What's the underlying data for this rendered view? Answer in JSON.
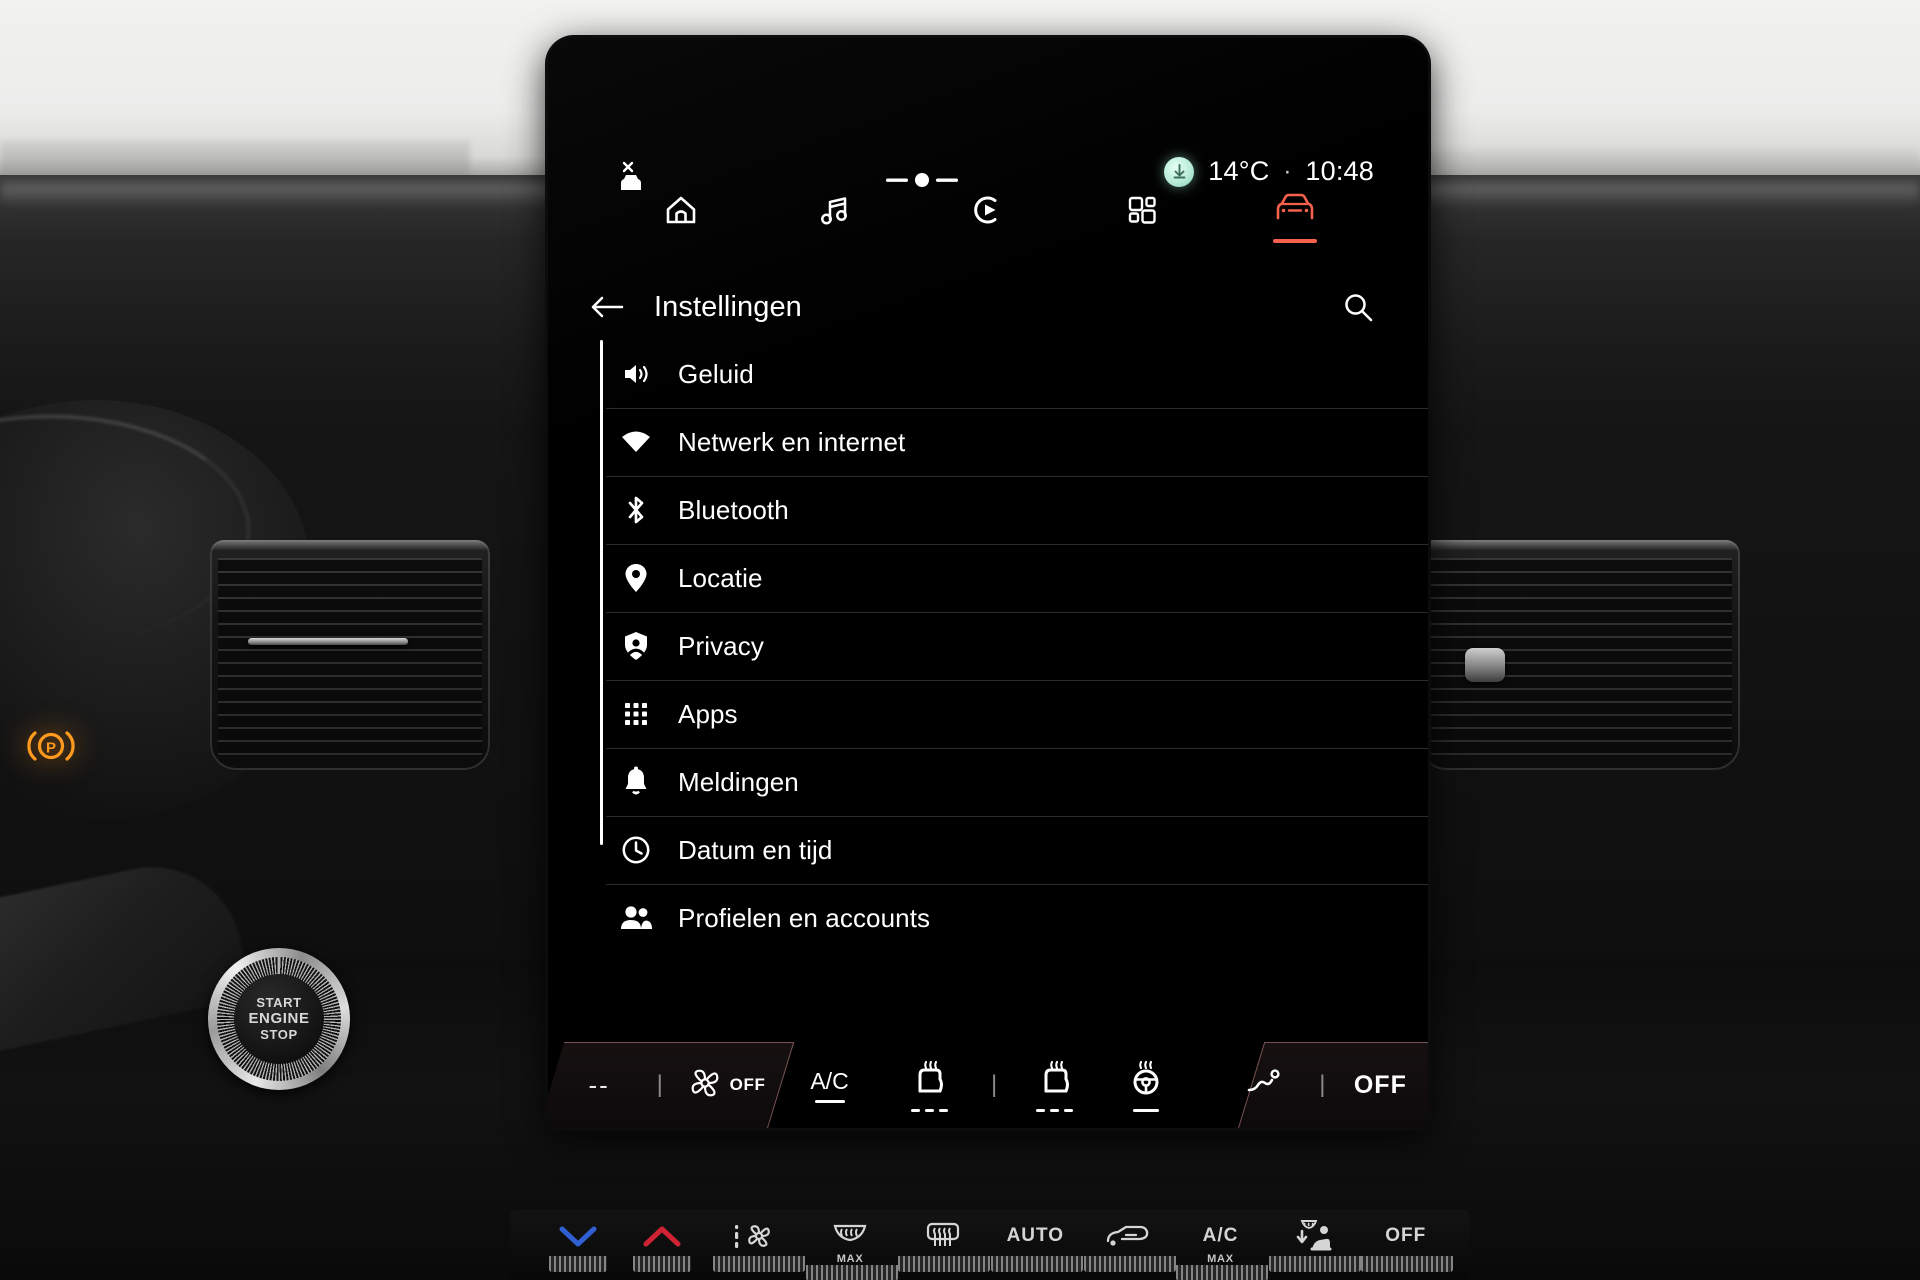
{
  "status": {
    "vehicle_icon": "car-disconnected-icon",
    "volume_icon": "volume-slider-icon",
    "badge_icon": "download-circle-icon",
    "temperature": "14°C",
    "separator": "·",
    "time": "10:48"
  },
  "nav": {
    "items": [
      {
        "name": "home",
        "icon": "home-icon",
        "label": "Home",
        "active": false
      },
      {
        "name": "media",
        "icon": "music-note-icon",
        "label": "Media",
        "active": false
      },
      {
        "name": "radio",
        "icon": "play-circle-icon",
        "label": "Radio",
        "active": false
      },
      {
        "name": "apps",
        "icon": "apps-grid-icon",
        "label": "Apps",
        "active": false
      },
      {
        "name": "vehicle",
        "icon": "car-icon",
        "label": "Voertuig",
        "active": true
      }
    ],
    "active_color": "#f4614d"
  },
  "header": {
    "back_icon": "back-arrow-icon",
    "title": "Instellingen",
    "search_icon": "search-icon"
  },
  "settings": {
    "items": [
      {
        "icon": "speaker-icon",
        "label": "Geluid"
      },
      {
        "icon": "wifi-icon",
        "label": "Netwerk en internet"
      },
      {
        "icon": "bluetooth-icon",
        "label": "Bluetooth"
      },
      {
        "icon": "location-pin-icon",
        "label": "Locatie"
      },
      {
        "icon": "shield-person-icon",
        "label": "Privacy"
      },
      {
        "icon": "apps-dots-icon",
        "label": "Apps"
      },
      {
        "icon": "bell-icon",
        "label": "Meldingen"
      },
      {
        "icon": "clock-icon",
        "label": "Datum en tijd"
      },
      {
        "icon": "people-icon",
        "label": "Profielen en accounts"
      }
    ],
    "scrollbar": {
      "visible": true
    }
  },
  "climate": {
    "left_temp": "--",
    "fan_icon": "fan-icon",
    "fan_state": "OFF",
    "ac_label": "A/C",
    "seat_heat_driver_icon": "heated-seat-icon",
    "seat_heat_passenger_icon": "heated-seat-icon",
    "steering_heat_icon": "heated-steering-wheel-icon",
    "airflow_icon": "airflow-icon",
    "right_state": "OFF"
  },
  "hvac_panel": {
    "buttons": [
      {
        "name": "temp-down",
        "icon": "chevron-down-icon",
        "label": "",
        "sub": "",
        "color": "#2f5fd0"
      },
      {
        "name": "temp-up",
        "icon": "chevron-up-icon",
        "label": "",
        "sub": "",
        "color": "#cf2233"
      },
      {
        "name": "fan-speed",
        "icon": "fan-bars-icon",
        "label": "",
        "sub": ""
      },
      {
        "name": "front-defrost",
        "icon": "front-defrost-icon",
        "label": "",
        "sub": "MAX"
      },
      {
        "name": "rear-defrost",
        "icon": "rear-defrost-icon",
        "label": "",
        "sub": ""
      },
      {
        "name": "auto",
        "icon": "",
        "label": "AUTO",
        "sub": ""
      },
      {
        "name": "recirculation",
        "icon": "recirculation-icon",
        "label": "",
        "sub": ""
      },
      {
        "name": "ac-max",
        "icon": "",
        "label": "A/C",
        "sub": "MAX"
      },
      {
        "name": "defrost-occupant",
        "icon": "defrost-person-icon",
        "label": "",
        "sub": ""
      },
      {
        "name": "climate-off",
        "icon": "",
        "label": "OFF",
        "sub": ""
      }
    ]
  },
  "cluster": {
    "parking_brake_icon": "parking-brake-warning-icon",
    "parking_brake_letter": "P",
    "parking_brake_color": "#ff8c14"
  },
  "start_button": {
    "line1": "START",
    "line2": "ENGINE",
    "line3": "STOP"
  }
}
